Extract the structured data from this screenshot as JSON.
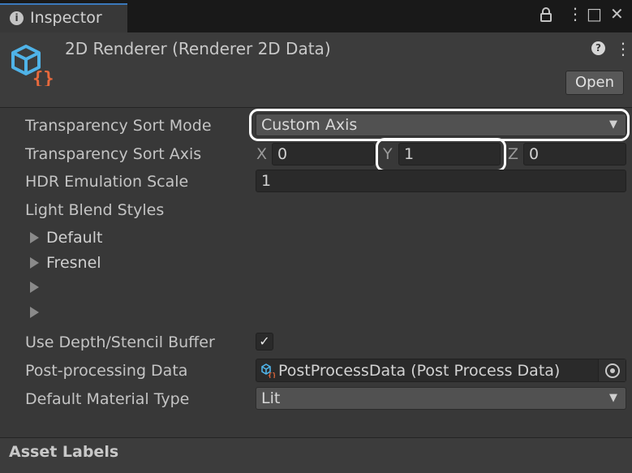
{
  "tab": {
    "label": "Inspector",
    "info_icon": "i"
  },
  "window_controls": {
    "lock": "lock-icon",
    "menu": "⋮",
    "maximize": "□",
    "close": "✕"
  },
  "header": {
    "title": "2D Renderer (Renderer 2D Data)",
    "help_icon": "?",
    "menu_icon": "⋮",
    "open_button": "Open"
  },
  "properties": {
    "sort_mode": {
      "label": "Transparency Sort Mode",
      "value": "Custom Axis"
    },
    "sort_axis": {
      "label": "Transparency Sort Axis",
      "x_label": "X",
      "x_value": "0",
      "y_label": "Y",
      "y_value": "1",
      "z_label": "Z",
      "z_value": "0"
    },
    "hdr": {
      "label": "HDR Emulation Scale",
      "value": "1"
    },
    "light_blend": {
      "label": "Light Blend Styles",
      "items": [
        "Default",
        "Fresnel",
        "",
        ""
      ]
    },
    "depth_stencil": {
      "label": "Use Depth/Stencil Buffer",
      "checked": true,
      "check_glyph": "✓"
    },
    "post_processing": {
      "label": "Post-processing Data",
      "value": "PostProcessData (Post Process Data)"
    },
    "material_type": {
      "label": "Default Material Type",
      "value": "Lit"
    }
  },
  "footer": {
    "label": "Asset Labels"
  },
  "colors": {
    "tab_accent": "#3a79bb",
    "asset_icon_cube": "#4fb3e8",
    "asset_icon_braces": "#e8693c",
    "highlight": "#ffffff"
  }
}
